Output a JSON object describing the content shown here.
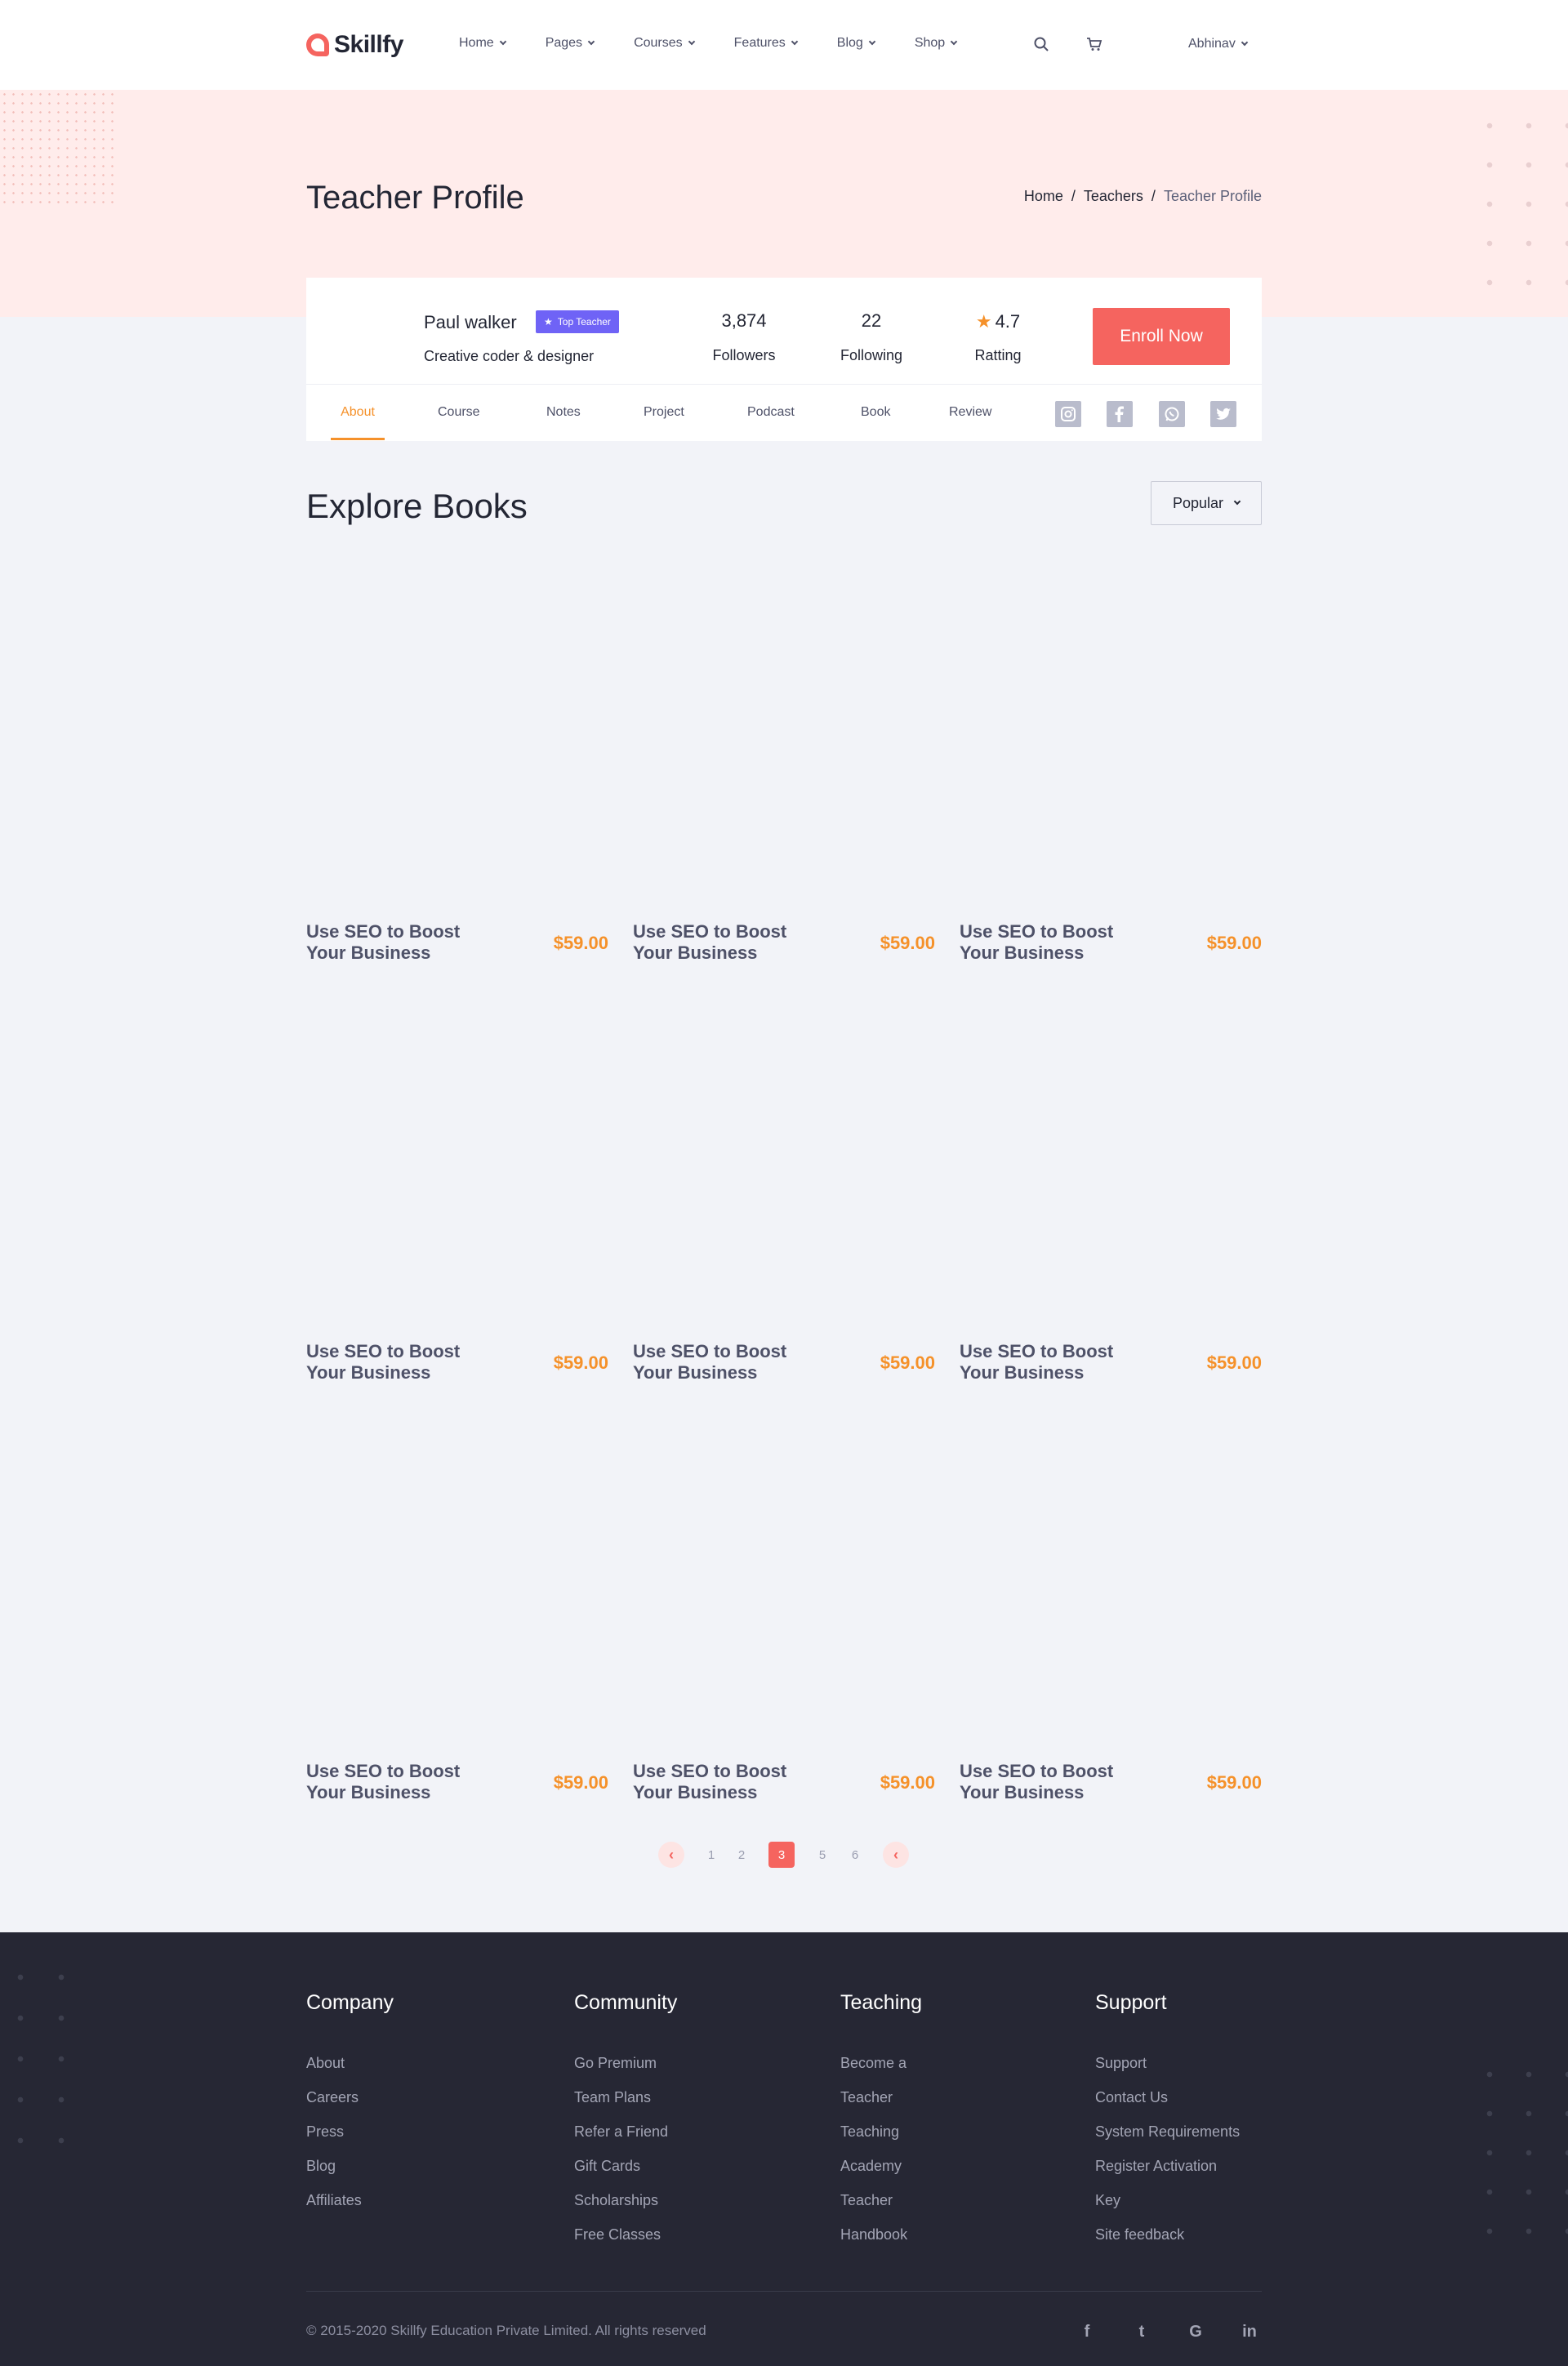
{
  "brand": {
    "name": "Skillfy",
    "accent": "#f5645f",
    "orange": "#f5912a",
    "purple": "#6f63f6"
  },
  "nav": {
    "items": [
      "Home",
      "Pages",
      "Courses",
      "Features",
      "Blog",
      "Shop"
    ],
    "user": "Abhinav"
  },
  "hero": {
    "title": "Teacher Profile",
    "breadcrumb": [
      "Home",
      "Teachers",
      "Teacher Profile"
    ]
  },
  "profile": {
    "name": "Paul walker",
    "badge": "Top Teacher",
    "role": "Creative coder & designer",
    "stats": {
      "followers": {
        "value": "3,874",
        "label": "Followers"
      },
      "following": {
        "value": "22",
        "label": "Following"
      },
      "rating": {
        "value": "4.7",
        "label": "Ratting"
      }
    },
    "enroll_label": "Enroll Now",
    "tabs": [
      "About",
      "Course",
      "Notes",
      "Project",
      "Podcast",
      "Book",
      "Review"
    ],
    "active_tab": "About",
    "social_icons": [
      "instagram-icon",
      "facebook-icon",
      "whatsapp-icon",
      "twitter-icon"
    ]
  },
  "explore": {
    "title": "Explore Books",
    "sort_label": "Popular",
    "books": [
      {
        "title": "Use SEO to Boost Your Business",
        "price": "$59.00"
      },
      {
        "title": "Use SEO to Boost Your Business",
        "price": "$59.00"
      },
      {
        "title": "Use SEO to Boost Your Business",
        "price": "$59.00"
      },
      {
        "title": "Use SEO to Boost Your Business",
        "price": "$59.00"
      },
      {
        "title": "Use SEO to Boost Your Business",
        "price": "$59.00"
      },
      {
        "title": "Use SEO to Boost Your Business",
        "price": "$59.00"
      },
      {
        "title": "Use SEO to Boost Your Business",
        "price": "$59.00"
      },
      {
        "title": "Use SEO to Boost Your Business",
        "price": "$59.00"
      },
      {
        "title": "Use SEO to Boost Your Business",
        "price": "$59.00"
      }
    ]
  },
  "pagination": {
    "prev": "‹",
    "next": "‹",
    "pages": [
      "1",
      "2",
      "3",
      "5",
      "6"
    ],
    "current": "3"
  },
  "footer": {
    "columns": [
      {
        "heading": "Company",
        "links": [
          "About",
          "Careers",
          "Press",
          "Blog",
          "Affiliates"
        ]
      },
      {
        "heading": "Community",
        "links": [
          "Go Premium",
          "Team Plans",
          "Refer a Friend",
          "Gift Cards",
          "Scholarships",
          "Free Classes"
        ]
      },
      {
        "heading": "Teaching",
        "links": [
          "Become a",
          "Teacher",
          "Teaching",
          "Academy",
          "Teacher",
          "Handbook"
        ]
      },
      {
        "heading": "Support",
        "links": [
          "Support",
          "Contact Us",
          "System Requirements",
          "Register Activation",
          "Key",
          "Site feedback"
        ]
      }
    ],
    "copyright": "© 2015-2020 Skillfy Education Private Limited. All rights reserved",
    "social_icons": [
      "facebook-icon",
      "twitter-icon",
      "google-icon",
      "linkedin-icon"
    ],
    "social_glyphs": [
      "f",
      "t",
      "G",
      "in"
    ]
  }
}
